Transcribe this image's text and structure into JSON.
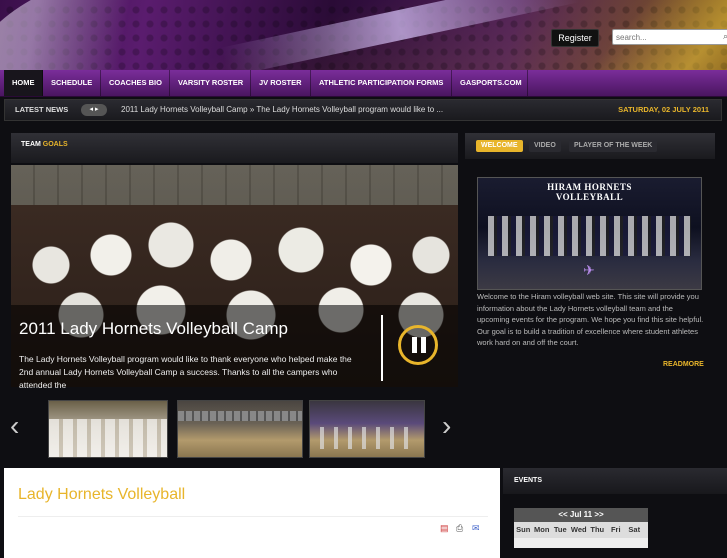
{
  "header": {
    "register_label": "Register",
    "search_placeholder": "search..."
  },
  "nav": {
    "items": [
      {
        "label": "HOME"
      },
      {
        "label": "SCHEDULE"
      },
      {
        "label": "COACHES BIO"
      },
      {
        "label": "VARSITY ROSTER"
      },
      {
        "label": "JV ROSTER"
      },
      {
        "label": "ATHLETIC PARTICIPATION FORMS"
      },
      {
        "label": "GASPORTS.COM"
      }
    ]
  },
  "ticker": {
    "label": "LATEST NEWS",
    "arrows": "◂ ▸",
    "headline": "2011 Lady Hornets Volleyball Camp » The Lady Hornets Volleyball program would like to ...",
    "date": "SATURDAY, 02 JULY 2011"
  },
  "feature": {
    "heading_main": "TEAM",
    "heading_accent": "GOALS",
    "title": "2011 Lady Hornets Volleyball Camp",
    "description": "The Lady Hornets Volleyball program would like to thank everyone who helped make the 2nd annual Lady Hornets Volleyball Camp a success.  Thanks to all the campers who attended the"
  },
  "right_panel": {
    "tabs": [
      {
        "label": "WELCOME"
      },
      {
        "label": "VIDEO"
      },
      {
        "label": "PLAYER OF THE WEEK"
      }
    ],
    "photo_title_1": "HIRAM HORNETS",
    "photo_title_2": "VOLLEYBALL",
    "welcome_text": "Welcome to the Hiram volleyball web site.  This site will provide you information about the Lady Hornets volleyball team and the upcoming events for the program. We hope you find this site helpful.  Our goal is to build a tradition of excellence where student athletes work hard on and off the court.",
    "readmore": "READMORE"
  },
  "content": {
    "heading": "Lady Hornets Volleyball"
  },
  "events": {
    "heading": "EVENTS",
    "calendar_header": "<< Jul 11 >>",
    "weekdays": [
      "Sun",
      "Mon",
      "Tue",
      "Wed",
      "Thu",
      "Fri",
      "Sat"
    ]
  },
  "colors": {
    "accent": "#e8b52b",
    "nav": "#6a2488"
  }
}
